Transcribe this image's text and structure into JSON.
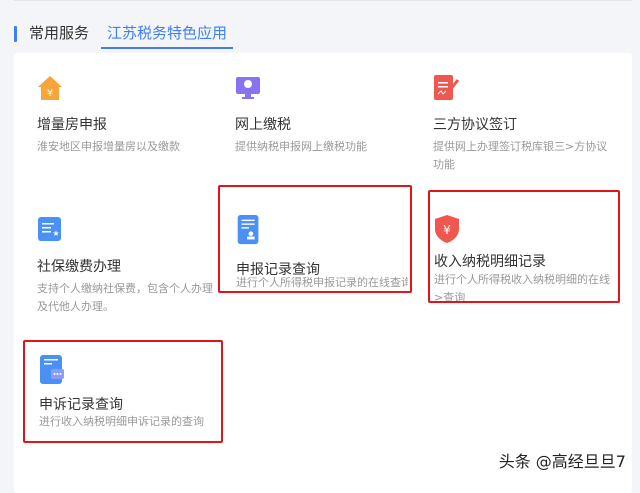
{
  "tabs": [
    {
      "label": "常用服务",
      "active": false
    },
    {
      "label": "江苏税务特色应用",
      "active": true
    }
  ],
  "items": [
    {
      "title": "增量房申报",
      "desc": "淮安地区申报增量房以及缴款",
      "icon": "house-yuan-icon",
      "color": "#f7a43a"
    },
    {
      "title": "网上缴税",
      "desc": "提供纳税申报网上缴税功能",
      "icon": "monitor-icon",
      "color": "#8b73f0"
    },
    {
      "title": "三方协议签订",
      "desc": "提供网上办理签订税库银三>方协议功能",
      "icon": "sign-document-icon",
      "color": "#f0574f"
    },
    {
      "title": "社保缴费办理",
      "desc": "支持个人缴纳社保费，包含个人办理及代他人办理。",
      "icon": "list-star-icon",
      "color": "#4a90f5"
    },
    {
      "title": "申报记录查询",
      "desc": "进行个人所得税申报记录的在线查询",
      "icon": "document-stamp-icon",
      "color": "#4a90f5"
    },
    {
      "title": "收入纳税明细记录",
      "desc": "进行个人所得税收入纳税明细的在线>查询",
      "icon": "shield-yuan-icon",
      "color": "#f0574f"
    },
    {
      "title": "申诉记录查询",
      "desc": "进行收入纳税明细申诉记录的查询",
      "icon": "document-chat-icon",
      "color": "#4a90f5"
    }
  ],
  "watermark": "头条 @高经旦旦7",
  "colors": {
    "accent": "#3f7ef6",
    "highlight": "#e0141c"
  }
}
